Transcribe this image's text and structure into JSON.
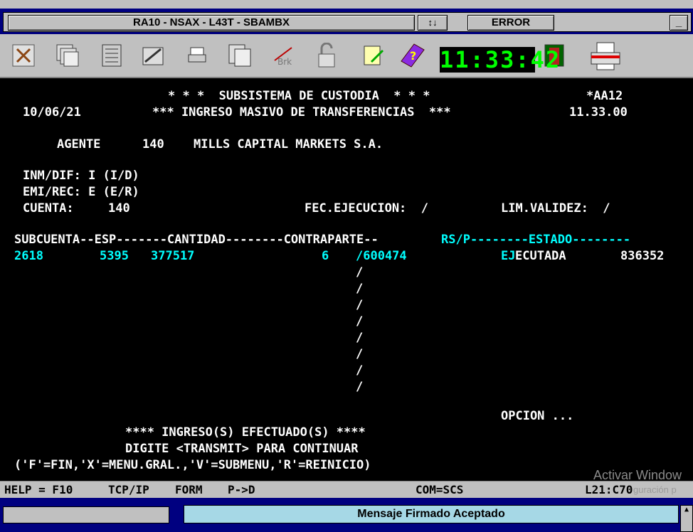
{
  "titlebar": {
    "title": "RA10 - NSAX - L43T - SBAMBX",
    "resize_icon": "↕↓",
    "error_label": "ERROR",
    "minimize_label": "_"
  },
  "toolbar": {
    "clock": "11:33:42",
    "icons": [
      "tools-icon",
      "windows-icon",
      "book-icon",
      "edit-icon",
      "printer-small-icon",
      "copy-icon",
      "brk-icon",
      "lock-icon",
      "notepad-icon",
      "help-book-icon",
      "door-icon",
      "printer-icon"
    ]
  },
  "screen": {
    "line1": "* * *  SUBSISTEMA DE CUSTODIA  * * *",
    "screen_code": "*AA12",
    "date": "10/06/21",
    "line2": "*** INGRESO MASIVO DE TRANSFERENCIAS  ***",
    "time": "11.33.00",
    "agente_label": "AGENTE",
    "agente_num": "140",
    "agente_name": "MILLS CAPITAL MARKETS S.A.",
    "inm_dif": "INM/DIF: I (I/D)",
    "emi_rec": "EMI/REC: E (E/R)",
    "cuenta_label": "CUENTA:",
    "cuenta_value": "140",
    "fec_ejecucion": "FEC.EJECUCION:  /",
    "lim_validez": "LIM.VALIDEZ:  /",
    "header_white": "SUBCUENTA--ESP-------CANTIDAD--------CONTRAPARTE--",
    "header_cyan": "RS/P--------ESTADO--------",
    "row": {
      "subcuenta": "2618",
      "esp": "5395",
      "cantidad": "377517",
      "contraparte": "6",
      "rsp": "/600474",
      "estado_cyan": "EJ",
      "estado_white": "ECUTADA",
      "nro": "836352"
    },
    "slashes": [
      "/",
      "/",
      "/",
      "/",
      "/",
      "/",
      "/",
      "/"
    ],
    "opcion": "OPCION ...",
    "msg1": "**** INGRESO(S) EFECTUADO(S) ****",
    "msg2": "DIGITE <TRANSMIT> PARA CONTINUAR",
    "msg3": "('F'=FIN,'X'=MENU.GRAL.,'V'=SUBMENU,'R'=REINICIO)",
    "watermark": "Activar Window"
  },
  "statusline": {
    "help": "HELP = F10",
    "tcp": "TCP/IP",
    "form": "FORM",
    "pd": "P->D",
    "com": "COM=SCS",
    "pos": "L21:C70",
    "watermark2": "guración p"
  },
  "msgbar": {
    "message": "Mensaje Firmado Aceptado"
  }
}
